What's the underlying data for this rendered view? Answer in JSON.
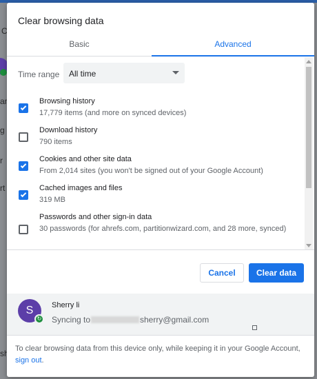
{
  "dialog": {
    "title": "Clear browsing data",
    "tabs": [
      {
        "label": "Basic"
      },
      {
        "label": "Advanced"
      }
    ],
    "time_range": {
      "label": "Time range",
      "value": "All time"
    },
    "options": [
      {
        "title": "Browsing history",
        "description": "17,779 items (and more on synced devices)",
        "checked": true
      },
      {
        "title": "Download history",
        "description": "790 items",
        "checked": false
      },
      {
        "title": "Cookies and other site data",
        "description": "From 2,014 sites (you won't be signed out of your Google Account)",
        "checked": true
      },
      {
        "title": "Cached images and files",
        "description": "319 MB",
        "checked": true
      },
      {
        "title": "Passwords and other sign-in data",
        "description": "30 passwords (for ahrefs.com, partitionwizard.com, and 28 more, synced)",
        "checked": false
      }
    ],
    "buttons": {
      "cancel": "Cancel",
      "clear": "Clear data"
    },
    "account": {
      "initial": "S",
      "name": "Sherry li",
      "sync_prefix": "Syncing to",
      "email_suffix": "sherry@gmail.com"
    },
    "footer": {
      "text": "To clear browsing data from this device only, while keeping it in your Google Account,",
      "link": "sign out",
      "end": "."
    }
  },
  "background": {
    "fragments": [
      "C",
      "ar",
      "g",
      "r",
      "rt",
      "sh"
    ]
  },
  "colors": {
    "accent": "#1a73e8",
    "avatar": "#5c3ea8",
    "sync": "#1e8e3e"
  }
}
